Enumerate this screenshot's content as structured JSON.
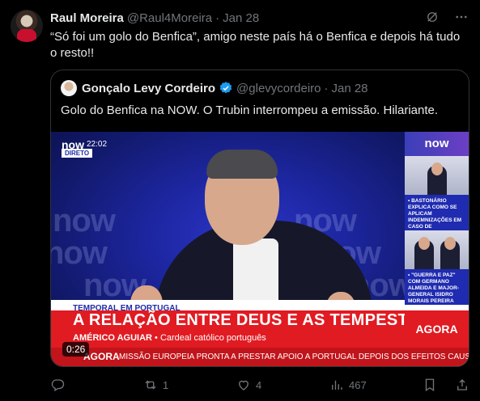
{
  "tweet": {
    "author_name": "Raul Moreira",
    "author_handle": "@Raul4Moreira",
    "separator": "·",
    "date": "Jan 28",
    "text": "“Só foi um golo do Benfica”, amigo neste país há o Benfica e depois há tudo o resto!!"
  },
  "quoted": {
    "author_name": "Gonçalo Levy Cordeiro",
    "author_handle": "@glevycordeiro",
    "separator": "·",
    "date": "Jan 28",
    "text": "Golo do Benfica na NOW. O Trubin interrompeu a emissão. Hilariante."
  },
  "video": {
    "channel": "now",
    "time": "22:02",
    "live": "DIRETO",
    "background_words": [
      "now",
      "now",
      "now",
      "now",
      "now",
      "now"
    ],
    "side_logo": "now",
    "side_items": [
      "• BASTONÁRIO EXPLICA COMO SE APLICAM INDEMNIZAÇÕES EM CASO DE TEMPESTADE",
      "• \"GUERRA E PAZ\" COM GERMANO ALMEIDA E MAJOR-GENERAL ISIDRO MORAIS PEREIRA"
    ],
    "tag": "TEMPORAL EM PORTUGAL",
    "headline": "A RELAÇÃO ENTRE DEUS E AS TEMPESTADES",
    "guest_name": "AMÉRICO AGUIAR",
    "guest_role": "• Cardeal católico português",
    "agora": "AGORA",
    "ticker_label": "AGORA",
    "ticker_text": "MISSÃO EUROPEIA PRONTA A PRESTAR APOIO A PORTUGAL DEPOIS DOS EFEITOS CAUSA",
    "duration": "0:26"
  },
  "actions": {
    "reply_count": "",
    "retweet_count": "1",
    "like_count": "4",
    "views_count": "467"
  },
  "colors": {
    "background": "#000000",
    "muted": "#71767b",
    "verified": "#1d9bf0",
    "news_red": "#e11b22",
    "news_blue": "#1f2bb0"
  }
}
